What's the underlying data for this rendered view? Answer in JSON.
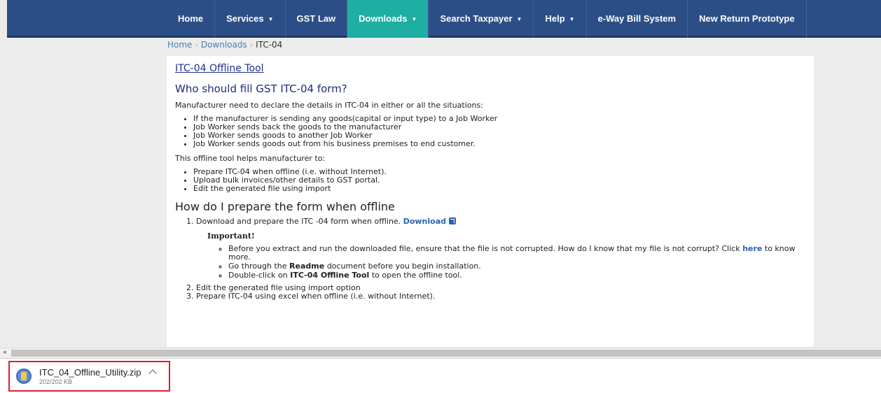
{
  "nav": {
    "items": [
      {
        "label": "Home",
        "caret": false
      },
      {
        "label": "Services",
        "caret": true
      },
      {
        "label": "GST Law",
        "caret": false
      },
      {
        "label": "Downloads",
        "caret": true,
        "active": true
      },
      {
        "label": "Search Taxpayer",
        "caret": true
      },
      {
        "label": "Help",
        "caret": true
      },
      {
        "label": "e-Way Bill System",
        "caret": false
      },
      {
        "label": "New Return Prototype",
        "caret": false
      }
    ],
    "caret_glyph": "▼",
    "active_color": "#1eaea2",
    "bar_color": "#2c4e86"
  },
  "breadcrumb": {
    "home": "Home",
    "downloads": "Downloads",
    "current": "ITC-04",
    "separator": "›"
  },
  "content": {
    "tool_link": "ITC-04 Offline Tool",
    "who_heading": "Who should fill GST ITC-04 form?",
    "who_intro": "Manufacturer need to declare the details in ITC-04 in either or all the situations:",
    "situations": [
      "If the manufacturer is sending any goods(capital or input type) to a Job Worker",
      "Job Worker sends back the goods to the manufacturer",
      "Job Worker sends goods to another Job Worker",
      "Job Worker sends goods out from his business premises to end customer."
    ],
    "helps_intro": "This offline tool helps manufacturer to:",
    "helps": [
      "Prepare ITC-04 when offline (i.e. without Internet).",
      "Upload bulk invoices/other details to GST portal.",
      "Edit the generated file using import"
    ],
    "prepare_heading": "How do I prepare the form when offline",
    "step1_text": "Download and prepare the ITC -04 form when offline.",
    "step1_link": "Download",
    "important": "Important!",
    "note1_pre": "Before you extract and run the downloaded file, ensure that the file is not corrupted. How do I know that my file is not corrupt? Click",
    "note1_link": "here",
    "note1_post": "to know more.",
    "note2_pre": "Go through the",
    "note2_bold": "Readme",
    "note2_post": "document before you begin installation.",
    "note3_pre": "Double-click on",
    "note3_bold": "ITC-04 Offline Tool",
    "note3_post": "to open the offline tool.",
    "step2": "Edit the generated file using import option",
    "step3": "Prepare ITC-04 using excel when offline (i.e. without Internet)."
  },
  "scrollbar": {
    "left_arrow": "◂"
  },
  "download": {
    "file_name": "ITC_04_Offline_Utility.zip",
    "file_size": "202/202 KB",
    "icon": "zip-file-icon",
    "highlight_color": "#e01f26"
  }
}
